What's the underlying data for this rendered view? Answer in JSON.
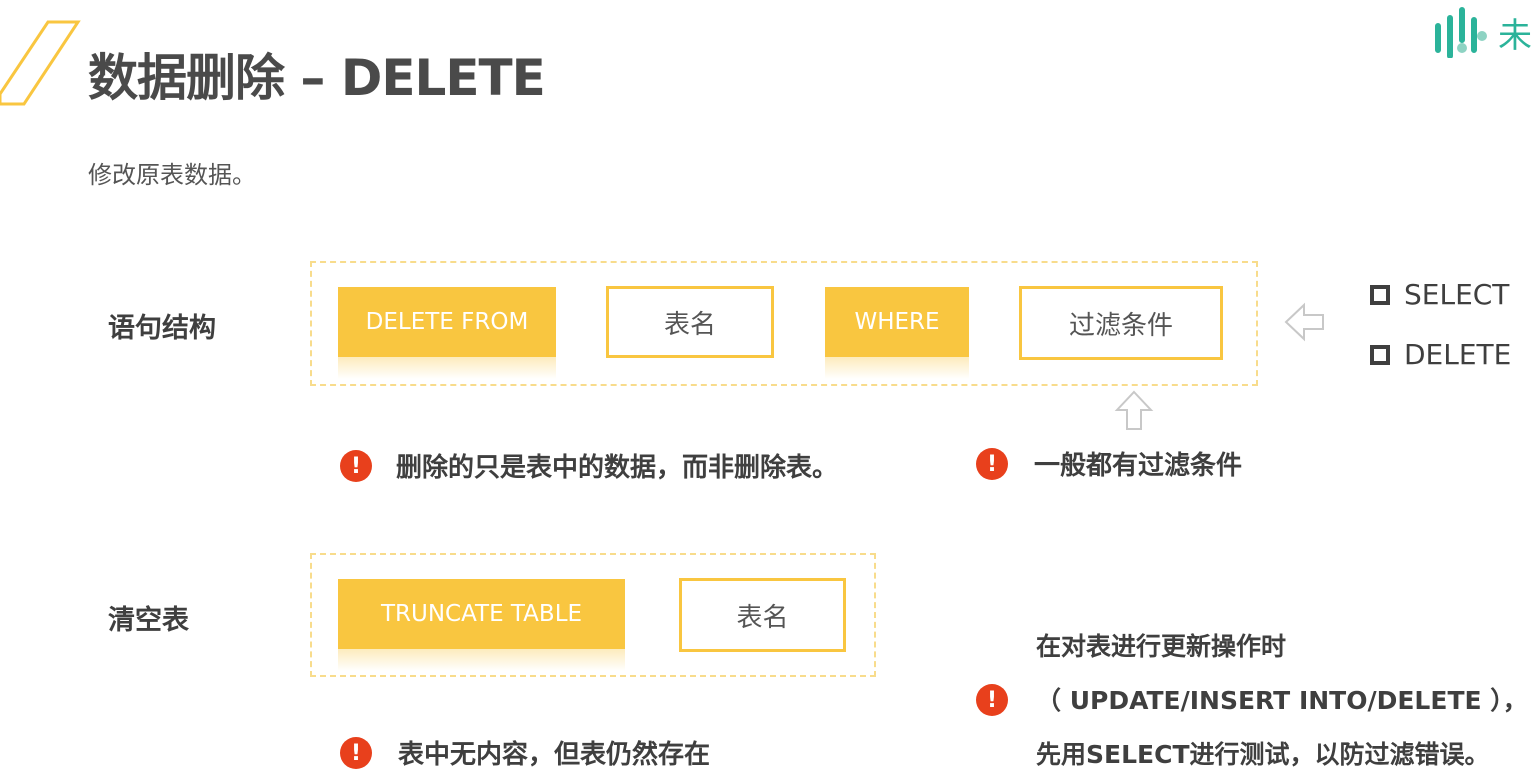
{
  "slide": {
    "title": "数据删除 – DELETE",
    "subtitle": "修改原表数据。",
    "brand_text": "未"
  },
  "syntax_section": {
    "label": "语句结构",
    "tokens": [
      "DELETE FROM",
      "表名",
      "WHERE",
      "过滤条件"
    ],
    "notes": [
      "删除的只是表中的数据，而非删除表。",
      "一般都有过滤条件"
    ],
    "note_icon": "!"
  },
  "options_list": {
    "items": [
      "SELECT",
      "DELETE"
    ]
  },
  "truncate_section": {
    "label": "清空表",
    "tokens": [
      "TRUNCATE TABLE",
      "表名"
    ],
    "note": "表中无内容，但表仍然存在",
    "note_icon": "!"
  },
  "warning": {
    "icon": "!",
    "lines": [
      "在对表进行更新操作时",
      "（ UPDATE/INSERT INTO/DELETE ），",
      "先用SELECT进行测试，以防过滤错误。"
    ]
  },
  "colors": {
    "accent": "#f9c640",
    "alert": "#e8401c",
    "brand": "#2bb39a"
  }
}
